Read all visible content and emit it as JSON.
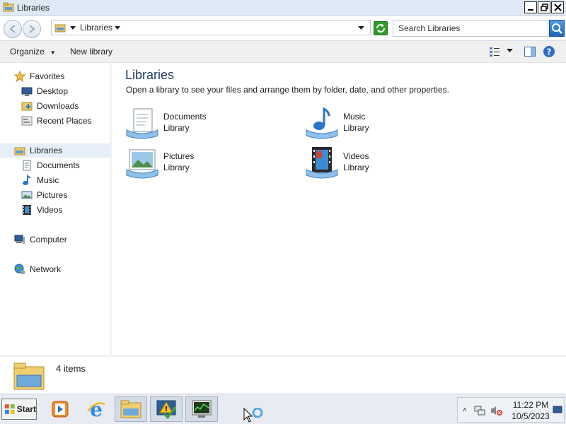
{
  "window": {
    "title": "Libraries",
    "buttons": {
      "minimize": "minimize",
      "maximize": "restore",
      "close": "close"
    }
  },
  "address": {
    "breadcrumb": "Libraries",
    "search_placeholder": "Search Libraries"
  },
  "toolbar": {
    "organize_label": "Organize",
    "new_library_label": "New library"
  },
  "nav": {
    "favorites": {
      "label": "Favorites",
      "items": [
        "Desktop",
        "Downloads",
        "Recent Places"
      ]
    },
    "libraries": {
      "label": "Libraries",
      "items": [
        "Documents",
        "Music",
        "Pictures",
        "Videos"
      ]
    },
    "computer": "Computer",
    "network": "Network"
  },
  "content": {
    "heading": "Libraries",
    "description": "Open a library to see your files and arrange them by folder, date, and other properties.",
    "libraries": [
      {
        "name": "Documents",
        "type": "Library",
        "icon": "documents-library-icon"
      },
      {
        "name": "Music",
        "type": "Library",
        "icon": "music-library-icon"
      },
      {
        "name": "Pictures",
        "type": "Library",
        "icon": "pictures-library-icon"
      },
      {
        "name": "Videos",
        "type": "Library",
        "icon": "videos-library-icon"
      }
    ]
  },
  "details": {
    "count": "4 items"
  },
  "taskbar": {
    "start_label": "Start",
    "apps": [
      "media-player",
      "internet-explorer",
      "windows-explorer",
      "action-center",
      "task-manager"
    ],
    "clock": {
      "time": "11:22 PM",
      "date": "10/5/2023"
    }
  }
}
